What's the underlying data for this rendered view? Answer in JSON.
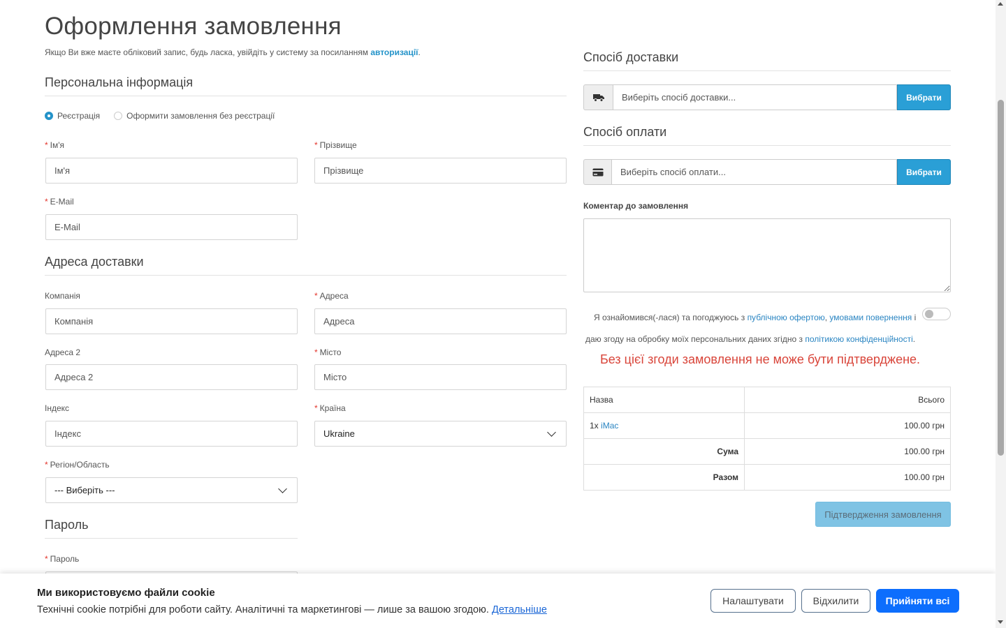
{
  "page_title": "Оформлення замовлення",
  "login_note": {
    "text": "Якщо Ви вже маєте обліковий запис, будь ласка, увійдіть у систему за посиланням ",
    "link": "авторизації",
    "end": "."
  },
  "personal": {
    "heading": "Персональна інформація",
    "account_options": [
      "Реєстрація",
      "Оформити замовлення без реєстрації"
    ],
    "selected_option": "Реєстрація",
    "firstname": {
      "label": "Ім'я",
      "placeholder": "Ім'я"
    },
    "lastname": {
      "label": "Прізвище",
      "placeholder": "Прізвище"
    },
    "email": {
      "label": "E-Mail",
      "placeholder": "E-Mail"
    }
  },
  "address": {
    "heading": "Адреса доставки",
    "company": {
      "label": "Компанія",
      "placeholder": "Компанія"
    },
    "address1": {
      "label": "Адреса",
      "placeholder": "Адреса"
    },
    "address2": {
      "label": "Адреса 2",
      "placeholder": "Адреса 2"
    },
    "city": {
      "label": "Місто",
      "placeholder": "Місто"
    },
    "postcode": {
      "label": "Індекс",
      "placeholder": "Індекс"
    },
    "country": {
      "label": "Країна",
      "value": "Ukraine"
    },
    "region": {
      "label": "Регіон/Область",
      "value": "--- Виберіть ---"
    }
  },
  "password": {
    "heading": "Пароль",
    "label": "Пароль"
  },
  "required_mark": "*",
  "shipping": {
    "heading": "Спосіб доставки",
    "placeholder": "Виберіть спосіб доставки...",
    "button": "Вибрати",
    "icon": "truck-icon"
  },
  "payment": {
    "heading": "Спосіб оплати",
    "placeholder": "Виберіть спосіб оплати...",
    "button": "Вибрати",
    "icon": "credit-card-icon"
  },
  "comment": {
    "label": "Коментар до замовлення"
  },
  "agreement": {
    "text1": "Я ознайомився(-лася) та погоджуюсь з ",
    "link1": "публічною офертою",
    "sep": ", ",
    "link2": "умовами повернення",
    "text2": " і даю згоду на обробку моїх персональних даних згідно з ",
    "link3": "політикою конфіденційності",
    "end": ".",
    "checked": false
  },
  "warning": "Без цієї згоди замовлення не може бути підтверджене.",
  "summary": {
    "header_name": "Назва",
    "header_total": "Всього",
    "item_qty": "1x",
    "item_name": "iMac",
    "item_total": "100.00 грн",
    "subtotal_label": "Сума",
    "subtotal_value": "100.00 грн",
    "total_label": "Разом",
    "total_value": "100.00 грн"
  },
  "confirm_button": "Підтвердження замовлення",
  "cookie": {
    "title": "Ми використовуємо файли cookie",
    "text": "Технічні cookie потрібні для роботи сайту. Аналітичні та маркетингові — лише за вашою згодою. ",
    "link": "Детальніше",
    "settings_button": "Налаштувати",
    "reject_button": "Відхилити",
    "accept_button": "Прийняти всі"
  },
  "colors": {
    "accent": "#2a9fd6",
    "link": "#2a85c2",
    "required": "#e3362d",
    "warning": "#d9453a",
    "cookie_primary": "#0d6efd"
  }
}
